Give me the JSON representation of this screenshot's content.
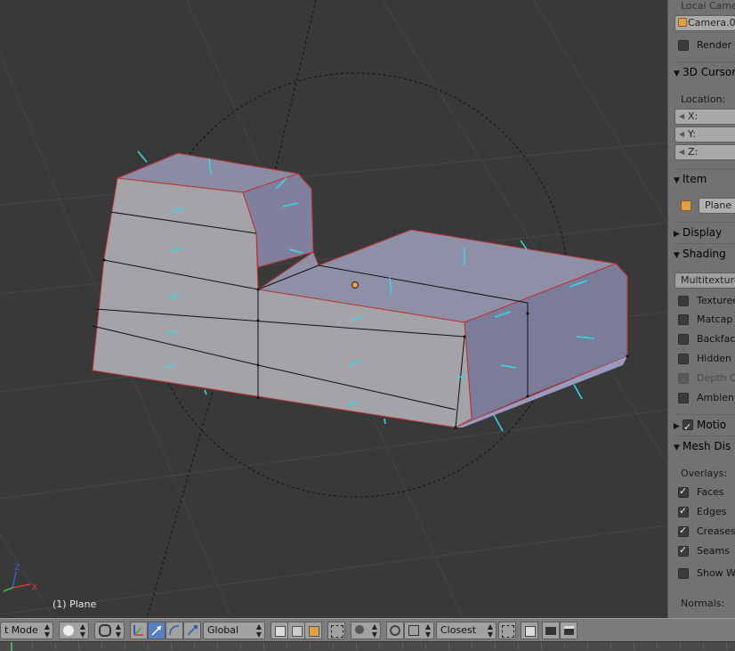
{
  "viewport": {
    "object_label": "(1) Plane"
  },
  "properties": {
    "local_camera_label": "Local Camera",
    "camera_field": "Camera.0",
    "render_border_label": "Render B",
    "cursor_panel_label": "3D Cursor",
    "location_label": "Location:",
    "x_label": "X:",
    "y_label": "Y:",
    "z_label": "Z:",
    "item_panel_label": "Item",
    "item_name": "Plane",
    "display_panel_label": "Display",
    "shading_panel_label": "Shading",
    "shading_mode": "Multitexture",
    "textured_solid": "Textured",
    "matcap": "Matcap",
    "backface_culling": "Backface",
    "hidden_wire": "Hidden W",
    "depth_of_field": "Depth Of",
    "ambient_occlusion": "Ambient",
    "motion_panel_label": "Motio",
    "mesh_display_panel_label": "Mesh Dis",
    "overlays_label": "Overlays:",
    "faces_label": "Faces",
    "edges_label": "Edges",
    "creases_label": "Creases",
    "seams_label": "Seams",
    "show_weights_label": "Show We",
    "normals_label": "Normals:"
  },
  "header": {
    "mode_label": "t Mode",
    "orientation_label": "Global",
    "snap_target_label": "Closest"
  },
  "colors": {
    "viewport_bg": "#393939",
    "panel_bg": "#727272",
    "header_bg": "#7c7c7c",
    "mesh_face": "#9b9ba6",
    "edge_selected": "#e88b2e",
    "normal_line": "#38d8e8",
    "active_button": "#5680c2"
  }
}
